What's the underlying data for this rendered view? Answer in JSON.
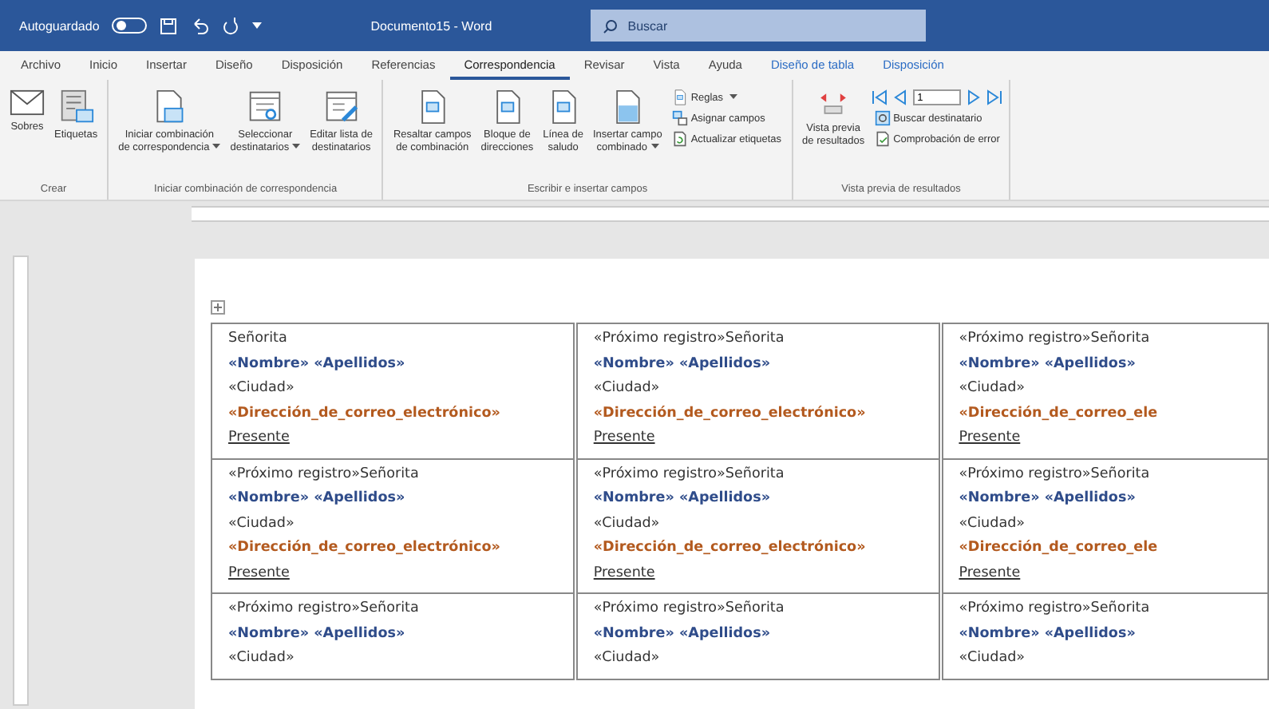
{
  "title_bar": {
    "autosave_label": "Autoguardado",
    "autosave_on": false,
    "document_title": "Documento15 - Word",
    "search_placeholder": "Buscar"
  },
  "tabs": [
    {
      "label": "Archivo",
      "selected": false,
      "kind": "normal"
    },
    {
      "label": "Inicio",
      "selected": false,
      "kind": "normal"
    },
    {
      "label": "Insertar",
      "selected": false,
      "kind": "normal"
    },
    {
      "label": "Diseño",
      "selected": false,
      "kind": "normal"
    },
    {
      "label": "Disposición",
      "selected": false,
      "kind": "normal"
    },
    {
      "label": "Referencias",
      "selected": false,
      "kind": "normal"
    },
    {
      "label": "Correspondencia",
      "selected": true,
      "kind": "normal"
    },
    {
      "label": "Revisar",
      "selected": false,
      "kind": "normal"
    },
    {
      "label": "Vista",
      "selected": false,
      "kind": "normal"
    },
    {
      "label": "Ayuda",
      "selected": false,
      "kind": "normal"
    },
    {
      "label": "Diseño de tabla",
      "selected": false,
      "kind": "contextual"
    },
    {
      "label": "Disposición",
      "selected": false,
      "kind": "contextual"
    }
  ],
  "ribbon_groups": [
    {
      "label": "Crear",
      "items": [
        {
          "kind": "large",
          "label": "Sobres",
          "dropdown": false
        },
        {
          "kind": "large",
          "label": "Etiquetas",
          "dropdown": false
        }
      ]
    },
    {
      "label": "Iniciar combinación de correspondencia",
      "items": [
        {
          "kind": "large",
          "label": "Iniciar combinación\nde correspondencia",
          "dropdown": true
        },
        {
          "kind": "large",
          "label": "Seleccionar\ndestinatarios",
          "dropdown": true
        },
        {
          "kind": "large",
          "label": "Editar lista de\ndestinatarios",
          "dropdown": false
        }
      ]
    },
    {
      "label": "Escribir e insertar campos",
      "items": [
        {
          "kind": "large",
          "label": "Resaltar campos\nde combinación",
          "dropdown": false
        },
        {
          "kind": "large",
          "label": "Bloque de\ndirecciones",
          "dropdown": false
        },
        {
          "kind": "large",
          "label": "Línea de\nsaludo",
          "dropdown": false
        },
        {
          "kind": "large",
          "label": "Insertar campo\ncombinado",
          "dropdown": true
        },
        {
          "kind": "stack",
          "entries": [
            {
              "label": "Reglas",
              "dropdown": true
            },
            {
              "label": "Asignar campos",
              "dropdown": false
            },
            {
              "label": "Actualizar etiquetas",
              "dropdown": false
            }
          ]
        }
      ]
    },
    {
      "label": "Vista previa de resultados",
      "items": [
        {
          "kind": "large",
          "label": "Vista previa\nde resultados",
          "dropdown": false
        },
        {
          "kind": "nav",
          "record": "1",
          "entries": [
            {
              "label": "Buscar destinatario",
              "dropdown": false
            },
            {
              "label": "Comprobación de error",
              "dropdown": false
            }
          ]
        }
      ]
    }
  ],
  "table": {
    "rows": [
      {
        "cells": [
          {
            "greeting": "Señorita",
            "name": "«Nombre» «Apellidos»",
            "city": "«Ciudad»",
            "email": "«Dirección_de_correo_electrónico»",
            "closing": "Presente"
          },
          {
            "greeting": "«Próximo registro»Señorita",
            "name": "«Nombre» «Apellidos»",
            "city": "«Ciudad»",
            "email": "«Dirección_de_correo_electrónico»",
            "closing": "Presente"
          },
          {
            "greeting": "«Próximo registro»Señorita",
            "name": "«Nombre» «Apellidos»",
            "city": "«Ciudad»",
            "email": "«Dirección_de_correo_ele",
            "closing": "Presente"
          }
        ]
      },
      {
        "cells": [
          {
            "greeting": "«Próximo registro»Señorita",
            "name": "«Nombre» «Apellidos»",
            "city": "«Ciudad»",
            "email": "«Dirección_de_correo_electrónico»",
            "closing": "Presente"
          },
          {
            "greeting": "«Próximo registro»Señorita",
            "name": "«Nombre» «Apellidos»",
            "city": "«Ciudad»",
            "email": "«Dirección_de_correo_electrónico»",
            "closing": "Presente"
          },
          {
            "greeting": "«Próximo registro»Señorita",
            "name": "«Nombre» «Apellidos»",
            "city": "«Ciudad»",
            "email": "«Dirección_de_correo_ele",
            "closing": "Presente"
          }
        ]
      },
      {
        "cells": [
          {
            "greeting": "«Próximo registro»Señorita",
            "name": "«Nombre» «Apellidos»",
            "city": "«Ciudad»"
          },
          {
            "greeting": "«Próximo registro»Señorita",
            "name": "«Nombre» «Apellidos»",
            "city": "«Ciudad»"
          },
          {
            "greeting": "«Próximo registro»Señorita",
            "name": "«Nombre» «Apellidos»",
            "city": "«Ciudad»"
          }
        ]
      }
    ]
  }
}
